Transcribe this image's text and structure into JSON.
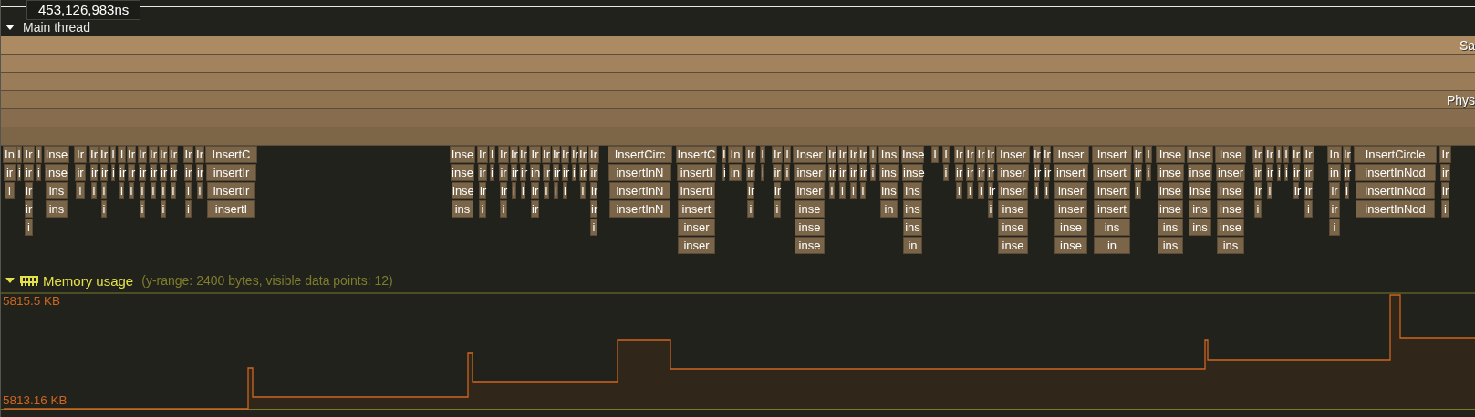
{
  "tooltip": {
    "text": "453,126,983ns"
  },
  "thread": {
    "name": "Main thread",
    "expanded": true,
    "frames": [
      {
        "kind": "zone",
        "label": "Sa"
      },
      {
        "kind": "zone"
      },
      {
        "kind": "zone"
      },
      {
        "kind": "zone",
        "label": "Phys"
      },
      {
        "kind": "zone"
      },
      {
        "kind": "zone"
      }
    ],
    "zones": [
      [
        "In",
        "ir",
        "i"
      ],
      [
        "I",
        "i"
      ],
      [
        "Ir",
        "ir",
        "ir",
        "ir",
        "i"
      ],
      [
        "I",
        "i"
      ],
      [
        "Inse",
        "inse",
        "ins",
        "ins"
      ],
      [
        "Ir",
        "ir",
        "i"
      ],
      [
        "Ir",
        "ir",
        "i"
      ],
      [
        "Ir",
        "ir",
        "i",
        "i"
      ],
      [
        "I",
        "i"
      ],
      [
        "I",
        "ir",
        "i"
      ],
      [
        "Ir",
        "ir",
        "i"
      ],
      [
        "Ir",
        "ir",
        "i",
        "i"
      ],
      [
        "Ir",
        "ir",
        "i"
      ],
      [
        "Ir",
        "ir",
        "i",
        "i"
      ],
      [
        "Ir",
        "ir",
        "i"
      ],
      [
        "Ir",
        "ir",
        "i",
        "i"
      ],
      [
        "Ir",
        "ir",
        "i"
      ],
      [
        "InsertC",
        "insertIr",
        "insertIr",
        "insertI"
      ],
      [
        "Inse",
        "inse",
        "inse",
        "ins"
      ],
      [
        "Ir",
        "ir",
        "ir",
        "i"
      ],
      [
        "I",
        "i"
      ],
      [
        "Ir",
        "ir",
        "ir",
        "i"
      ],
      [
        "Ir",
        "ir",
        "i"
      ],
      [
        "Ir",
        "ir",
        "i"
      ],
      [
        "Ir",
        "in",
        "ir",
        "ir"
      ],
      [
        "Ir",
        "ir",
        "i"
      ],
      [
        "Ir",
        "ir",
        "i"
      ],
      [
        "Ir",
        "ir",
        "i"
      ],
      [
        "Ir",
        "i"
      ],
      [
        "Ir",
        "ir",
        "i"
      ],
      [
        "Ir",
        "ir",
        "ir",
        "ir",
        "i"
      ],
      [
        "InsertCirc",
        "insertInN",
        "insertInN",
        "insertInN"
      ],
      [
        "InsertC",
        "insertI",
        "insertI",
        "insert",
        "inser",
        "inser"
      ],
      [
        "I",
        "i"
      ],
      [
        "In",
        "in"
      ],
      [
        "Ir",
        "ir",
        "ir",
        "i"
      ],
      [
        "I",
        "i"
      ],
      [
        "Ir",
        "ir",
        "ir",
        "i"
      ],
      [
        "I",
        "i"
      ],
      [
        "Inser",
        "inser",
        "inser",
        "inse",
        "inse",
        "inse"
      ],
      [
        "Ir",
        "ir",
        "i"
      ],
      [
        "Ir",
        "ir",
        "i"
      ],
      [
        "Ir",
        "ir",
        "i"
      ],
      [
        "Ir",
        "ir",
        "i"
      ],
      [
        "I",
        "i"
      ],
      [
        "Ins",
        "ins",
        "ins",
        "in"
      ],
      [
        "Inse",
        "inse",
        "ins",
        "ins",
        "ins",
        "in"
      ],
      [
        "I"
      ],
      [
        "I",
        "i"
      ],
      [
        "Ir",
        "ir",
        "i"
      ],
      [
        "Ir",
        "ir",
        "i"
      ],
      [
        "Ir",
        "ir",
        "i"
      ],
      [
        "Ir",
        "ir",
        "ir",
        "i"
      ],
      [
        "Inser",
        "inser",
        "inser",
        "inse",
        "inse",
        "inse"
      ],
      [
        "Ir",
        "ir",
        "i"
      ],
      [
        "Ir",
        "ir",
        "i"
      ],
      [
        "Inser",
        "insert",
        "inser",
        "inser",
        "inse",
        "inse"
      ],
      [
        "Insert",
        "insert",
        "insert",
        "insert",
        "ins",
        "in"
      ],
      [
        "Ir",
        "ir",
        "i"
      ],
      [
        "I",
        "i"
      ],
      [
        "Inse",
        "inse",
        "inse",
        "inse",
        "ins",
        "ins"
      ],
      [
        "Inse",
        "inse",
        "inse",
        "ins",
        "ins"
      ],
      [
        "Inse",
        "inser",
        "inse",
        "inse",
        "inse",
        "ins"
      ],
      [
        "Ir",
        "ir",
        "ir",
        "i"
      ],
      [
        "Ir",
        "ir",
        "i"
      ],
      [
        "I",
        "i"
      ],
      [
        "I",
        "i"
      ],
      [
        "Ir",
        "ir",
        "ir"
      ],
      [
        "Ir",
        "ir",
        "ir",
        "i"
      ],
      [
        "In",
        "in",
        "ir",
        "ir",
        "i"
      ],
      [
        "Ir",
        "ir",
        "i"
      ],
      [
        "InsertCircle",
        "insertInNod",
        "insertInNod",
        "insertInNod"
      ],
      [
        "Ir",
        "ir",
        "ir",
        "i"
      ]
    ]
  },
  "memory": {
    "name": "Memory usage",
    "expanded": true,
    "info": "(y-range: 2400 bytes, visible data points: 12)",
    "max_label": "5815.5 KB",
    "min_label": "5813.16 KB"
  }
}
